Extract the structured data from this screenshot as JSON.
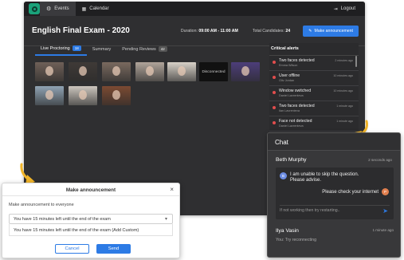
{
  "topbar": {
    "nav": [
      {
        "label": "Events",
        "icon": "gear-icon"
      },
      {
        "label": "Calendar",
        "icon": "calendar-icon"
      }
    ],
    "logout_label": "Logout"
  },
  "header": {
    "title": "English Final Exam - 2020",
    "duration_label": "Duration:",
    "duration_value": "09:00 AM - 11:00 AM",
    "total_label": "Total Candidates:",
    "total_value": "24",
    "announce_button": "Make announcement"
  },
  "tabs": [
    {
      "label": "Live Proctoring",
      "count": "18"
    },
    {
      "label": "Summary",
      "count": ""
    },
    {
      "label": "Pending Reviews",
      "count": "42"
    }
  ],
  "video_tiles": [
    {
      "status": "live",
      "color": "#6f6058"
    },
    {
      "status": "live",
      "color": "#3f3a37"
    },
    {
      "status": "live",
      "color": "#7a6a5f"
    },
    {
      "status": "live",
      "color": "#b0a49a"
    },
    {
      "status": "live",
      "color": "#d8d1c8"
    },
    {
      "status": "disconnected",
      "label": "Disconnected"
    },
    {
      "status": "live",
      "color": "#4d3e7a"
    },
    {
      "status": "live",
      "color": "#8fa3b4"
    },
    {
      "status": "live",
      "color": "#ccc6be"
    },
    {
      "status": "live",
      "color": "#7b4a32"
    }
  ],
  "critical_alerts": {
    "title": "Critical alerts",
    "items": [
      {
        "type": "Two faces detected",
        "name": "Emma Wilson",
        "ago": "2 minutes ago"
      },
      {
        "type": "User offline",
        "name": "Oliv Jordan",
        "ago": "10 minutes ago"
      },
      {
        "type": "Window switched",
        "name": "Daniel Lavrenteva",
        "ago": "10 minutes ago"
      },
      {
        "type": "Two faces detected",
        "name": "Ilan Lavrenteva",
        "ago": "1 minute ago"
      },
      {
        "type": "Face not detected",
        "name": "Daniel Lavrenteva",
        "ago": "1 minute ago"
      }
    ]
  },
  "chat": {
    "title": "Chat",
    "thread": {
      "sender": "Beth Murphy",
      "ago": "2 seconds ago",
      "student_initial": "B",
      "student_message": "I am unable to skip the question. Please advise.",
      "proctor_initial": "P",
      "proctor_message": "Please check your internet",
      "reply_placeholder": "If not working then try restarting.."
    },
    "second": {
      "sender": "Ilya Vasin",
      "ago": "1 minute ago",
      "preview": "You: Try reconnecting"
    }
  },
  "modal": {
    "title": "Make announcement",
    "label": "Make announcement to everyone",
    "selected": "You have 15 minutes left until the end of the exam",
    "option": "You have 15 minutes left until the end of the exam (Add Custom)",
    "cancel_label": "Cancel",
    "send_label": "Send"
  },
  "colors": {
    "accent": "#2d7be5",
    "alert_dot": "#e24d4d",
    "callout_arrow": "#f0b429"
  }
}
